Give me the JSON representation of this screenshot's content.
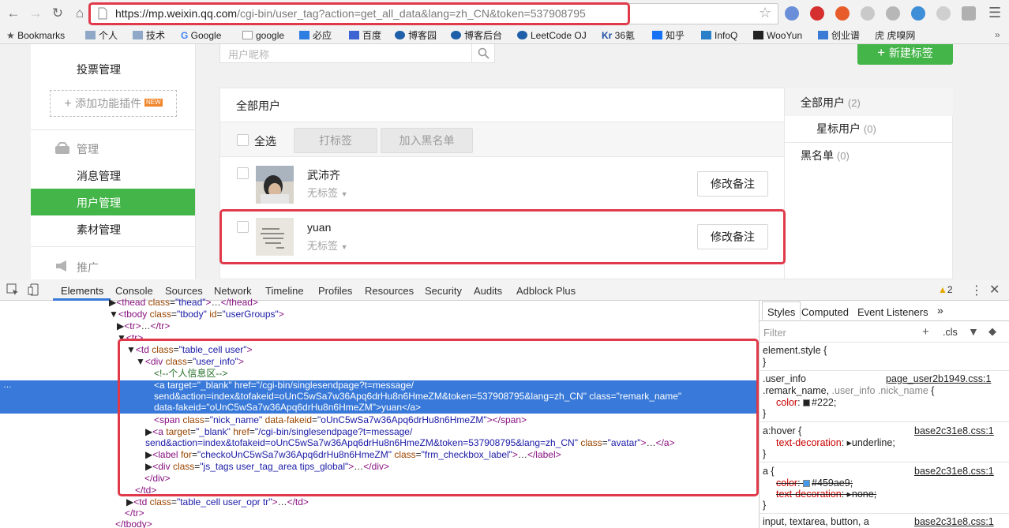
{
  "browser": {
    "url_host": "https://mp.weixin.qq.com",
    "url_path": "/cgi-bin/user_tag?action=get_all_data&lang=zh_CN&token=537908795",
    "bookmarks": [
      "Bookmarks",
      "个人",
      "技术",
      "Google",
      "google",
      "必应",
      "百度",
      "博客园",
      "博客后台",
      "LeetCode OJ",
      "36氪",
      "知乎",
      "InfoQ",
      "WooYun",
      "创业谱",
      "虎嗅网"
    ]
  },
  "sidebar": {
    "vote": "投票管理",
    "add_plugin": "添加功能插件",
    "new_badge": "NEW",
    "manage": "管理",
    "items": [
      "消息管理",
      "用户管理",
      "素材管理"
    ],
    "promote": "推广"
  },
  "main": {
    "search_placeholder": "用户昵称",
    "new_tag": "新建标签",
    "panel_title": "全部用户",
    "select_all": "全选",
    "tag_btn": "打标签",
    "blacklist_btn": "加入黑名单",
    "users": [
      {
        "name": "武沛齐",
        "tag": "无标签",
        "remark": "修改备注"
      },
      {
        "name": "yuan",
        "tag": "无标签",
        "remark": "修改备注"
      }
    ]
  },
  "groups": [
    {
      "label": "全部用户",
      "count": "(2)"
    },
    {
      "label": "星标用户",
      "count": "(0)"
    },
    {
      "label": "黑名单",
      "count": "(0)"
    }
  ],
  "devtools": {
    "tabs": [
      "Elements",
      "Console",
      "Sources",
      "Network",
      "Timeline",
      "Profiles",
      "Resources",
      "Security",
      "Audits",
      "Adblock Plus"
    ],
    "warn_count": "2",
    "styles_tabs": [
      "Styles",
      "Computed",
      "Event Listeners"
    ],
    "filter": "Filter",
    "cls": ".cls"
  },
  "colors": {
    "accent_green": "#44b549",
    "highlight_red": "#e03a4a",
    "selection_blue": "#3879d9"
  }
}
